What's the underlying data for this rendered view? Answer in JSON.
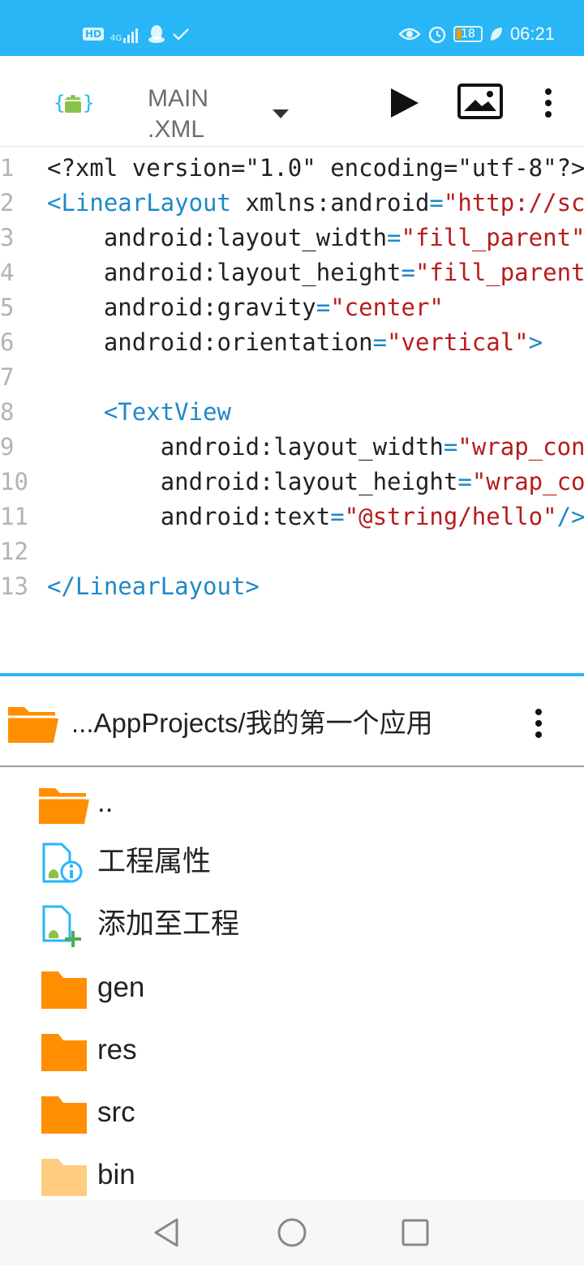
{
  "status_bar": {
    "network_badge": "HD",
    "network_type": "4G",
    "battery_level": "18",
    "time": "06:21",
    "icons": [
      "hd-icon",
      "signal-4g-icon",
      "qq-icon",
      "check-icon",
      "eye-icon",
      "alarm-icon",
      "battery-icon",
      "leaf-icon"
    ]
  },
  "toolbar": {
    "file_name_line1": "MAIN",
    "file_name_line2": ".XML",
    "icons": [
      "android-app-icon",
      "chevron-down-icon",
      "play-icon",
      "image-preview-icon",
      "more-vert-icon"
    ]
  },
  "editor": {
    "lines": [
      {
        "num": "1",
        "indent": "",
        "parts": [
          {
            "t": "<?xml version=\"1.0\" encoding=\"utf-8\"?>",
            "c": ""
          }
        ]
      },
      {
        "num": "2",
        "indent": "",
        "parts": [
          {
            "t": "<LinearLayout",
            "c": "tag"
          },
          {
            "t": " xmlns:android",
            "c": ""
          },
          {
            "t": "=",
            "c": "eq"
          },
          {
            "t": "\"http://schemas.android.com/apk/res/android\"",
            "c": "val"
          }
        ]
      },
      {
        "num": "3",
        "indent": "    ",
        "parts": [
          {
            "t": "android:layout_width",
            "c": ""
          },
          {
            "t": "=",
            "c": "eq"
          },
          {
            "t": "\"fill_parent\"",
            "c": "val"
          }
        ]
      },
      {
        "num": "4",
        "indent": "    ",
        "parts": [
          {
            "t": "android:layout_height",
            "c": ""
          },
          {
            "t": "=",
            "c": "eq"
          },
          {
            "t": "\"fill_parent\"",
            "c": "val"
          }
        ]
      },
      {
        "num": "5",
        "indent": "    ",
        "parts": [
          {
            "t": "android:gravity",
            "c": ""
          },
          {
            "t": "=",
            "c": "eq"
          },
          {
            "t": "\"center\"",
            "c": "val"
          }
        ]
      },
      {
        "num": "6",
        "indent": "    ",
        "parts": [
          {
            "t": "android:orientation",
            "c": ""
          },
          {
            "t": "=",
            "c": "eq"
          },
          {
            "t": "\"vertical\"",
            "c": "val"
          },
          {
            "t": ">",
            "c": "tag"
          }
        ]
      },
      {
        "num": "7",
        "indent": "",
        "parts": []
      },
      {
        "num": "8",
        "indent": "    ",
        "parts": [
          {
            "t": "<TextView",
            "c": "tag"
          }
        ]
      },
      {
        "num": "9",
        "indent": "        ",
        "parts": [
          {
            "t": "android:layout_width",
            "c": ""
          },
          {
            "t": "=",
            "c": "eq"
          },
          {
            "t": "\"wrap_content\"",
            "c": "val"
          }
        ]
      },
      {
        "num": "10",
        "indent": "        ",
        "parts": [
          {
            "t": "android:layout_height",
            "c": ""
          },
          {
            "t": "=",
            "c": "eq"
          },
          {
            "t": "\"wrap_content\"",
            "c": "val"
          }
        ]
      },
      {
        "num": "11",
        "indent": "        ",
        "parts": [
          {
            "t": "android:text",
            "c": ""
          },
          {
            "t": "=",
            "c": "eq"
          },
          {
            "t": "\"@string/hello\"",
            "c": "val"
          },
          {
            "t": "/>",
            "c": "tag"
          }
        ]
      },
      {
        "num": "12",
        "indent": "",
        "parts": []
      },
      {
        "num": "13",
        "indent": "",
        "parts": [
          {
            "t": "</LinearLayout>",
            "c": "tag"
          }
        ]
      }
    ]
  },
  "browser": {
    "path": "...AppProjects/我的第一个应用",
    "items": [
      {
        "label": "..",
        "icon": "folder-open-icon"
      },
      {
        "label": "工程属性",
        "icon": "project-properties-icon"
      },
      {
        "label": "添加至工程",
        "icon": "add-to-project-icon"
      },
      {
        "label": "gen",
        "icon": "folder-icon"
      },
      {
        "label": "res",
        "icon": "folder-icon"
      },
      {
        "label": "src",
        "icon": "folder-icon"
      },
      {
        "label": "bin",
        "icon": "folder-light-icon"
      }
    ]
  },
  "nav_bar": {
    "icons": [
      "back-icon",
      "home-icon",
      "recents-icon"
    ]
  },
  "colors": {
    "accent": "#29b6f6",
    "folder": "#ff8f00",
    "folder_light": "#ffcc80",
    "xml_tag": "#1e88c9",
    "xml_value": "#b71c1c"
  }
}
